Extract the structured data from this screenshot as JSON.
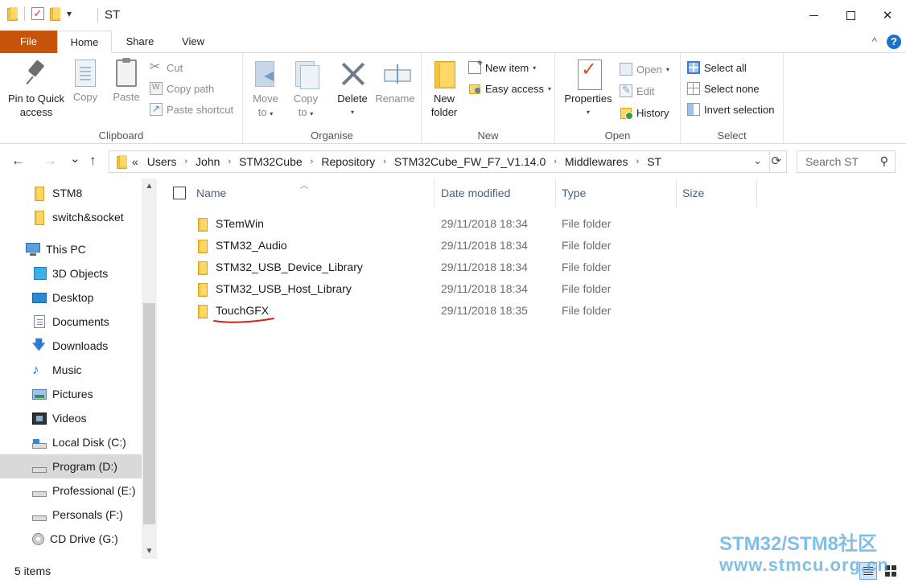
{
  "window": {
    "title": "ST",
    "minimize": "",
    "maximize": "",
    "close": "✕"
  },
  "qat": {
    "dropdown": "▾"
  },
  "tabs": {
    "file": "File",
    "home": "Home",
    "share": "Share",
    "view": "View",
    "collapse": "^",
    "help": "?"
  },
  "ribbon": {
    "clipboard": {
      "label": "Clipboard",
      "pin": "Pin to Quick access",
      "pin_line1": "Pin to Quick",
      "pin_line2": "access",
      "copy": "Copy",
      "paste": "Paste",
      "cut": "Cut",
      "copy_path": "Copy path",
      "paste_shortcut": "Paste shortcut"
    },
    "organise": {
      "label": "Organise",
      "move_to_line1": "Move",
      "move_to_line2": "to",
      "copy_to_line1": "Copy",
      "copy_to_line2": "to",
      "delete": "Delete",
      "rename": "Rename"
    },
    "new": {
      "label": "New",
      "new_folder_line1": "New",
      "new_folder_line2": "folder",
      "new_item": "New item",
      "easy_access": "Easy access"
    },
    "open": {
      "label": "Open",
      "properties": "Properties",
      "open": "Open",
      "edit": "Edit",
      "history": "History"
    },
    "select": {
      "label": "Select",
      "select_all": "Select all",
      "select_none": "Select none",
      "invert_selection": "Invert selection"
    }
  },
  "nav": {
    "back": "←",
    "forward": "→",
    "recent": "⌄",
    "up": "↑"
  },
  "address": {
    "overflow": "«",
    "crumbs": [
      "Users",
      "John",
      "STM32Cube",
      "Repository",
      "STM32Cube_FW_F7_V1.14.0",
      "Middlewares",
      "ST"
    ],
    "separator": "›",
    "dropdown": "⌄",
    "refresh": "⟳"
  },
  "search": {
    "placeholder": "Search ST",
    "icon": "⚲"
  },
  "navpane": {
    "items": [
      {
        "label": "STM8",
        "icon": "folder-icon"
      },
      {
        "label": "switch&socket",
        "icon": "folder-icon"
      },
      {
        "label": "This PC",
        "icon": "computer-icon"
      },
      {
        "label": "3D Objects",
        "icon": "3d-objects-icon"
      },
      {
        "label": "Desktop",
        "icon": "desktop-icon"
      },
      {
        "label": "Documents",
        "icon": "documents-icon"
      },
      {
        "label": "Downloads",
        "icon": "downloads-icon"
      },
      {
        "label": "Music",
        "icon": "music-icon"
      },
      {
        "label": "Pictures",
        "icon": "pictures-icon"
      },
      {
        "label": "Videos",
        "icon": "videos-icon"
      },
      {
        "label": "Local Disk (C:)",
        "icon": "windows-drive-icon"
      },
      {
        "label": "Program (D:)",
        "icon": "drive-icon",
        "selected": true
      },
      {
        "label": "Professional (E:)",
        "icon": "drive-icon"
      },
      {
        "label": "Personals (F:)",
        "icon": "drive-icon"
      },
      {
        "label": "CD Drive (G:)",
        "icon": "cd-drive-icon"
      }
    ],
    "scroll_up": "▲",
    "scroll_down": "▼"
  },
  "filelist": {
    "columns": {
      "name": "Name",
      "date": "Date modified",
      "type": "Type",
      "size": "Size"
    },
    "rows": [
      {
        "name": "STemWin",
        "date": "29/11/2018 18:34",
        "type": "File folder"
      },
      {
        "name": "STM32_Audio",
        "date": "29/11/2018 18:34",
        "type": "File folder"
      },
      {
        "name": "STM32_USB_Device_Library",
        "date": "29/11/2018 18:34",
        "type": "File folder"
      },
      {
        "name": "STM32_USB_Host_Library",
        "date": "29/11/2018 18:34",
        "type": "File folder"
      },
      {
        "name": "TouchGFX",
        "date": "29/11/2018 18:35",
        "type": "File folder"
      }
    ]
  },
  "status": {
    "count": "5 items"
  },
  "watermark": {
    "line1": "STM32/STM8社区",
    "line2": "www.stmcu.org.cn"
  },
  "colors": {
    "file_tab": "#c8530a",
    "folder": "#f5c542",
    "annotation": "#d61f1f",
    "accent": "#1a73c9"
  }
}
